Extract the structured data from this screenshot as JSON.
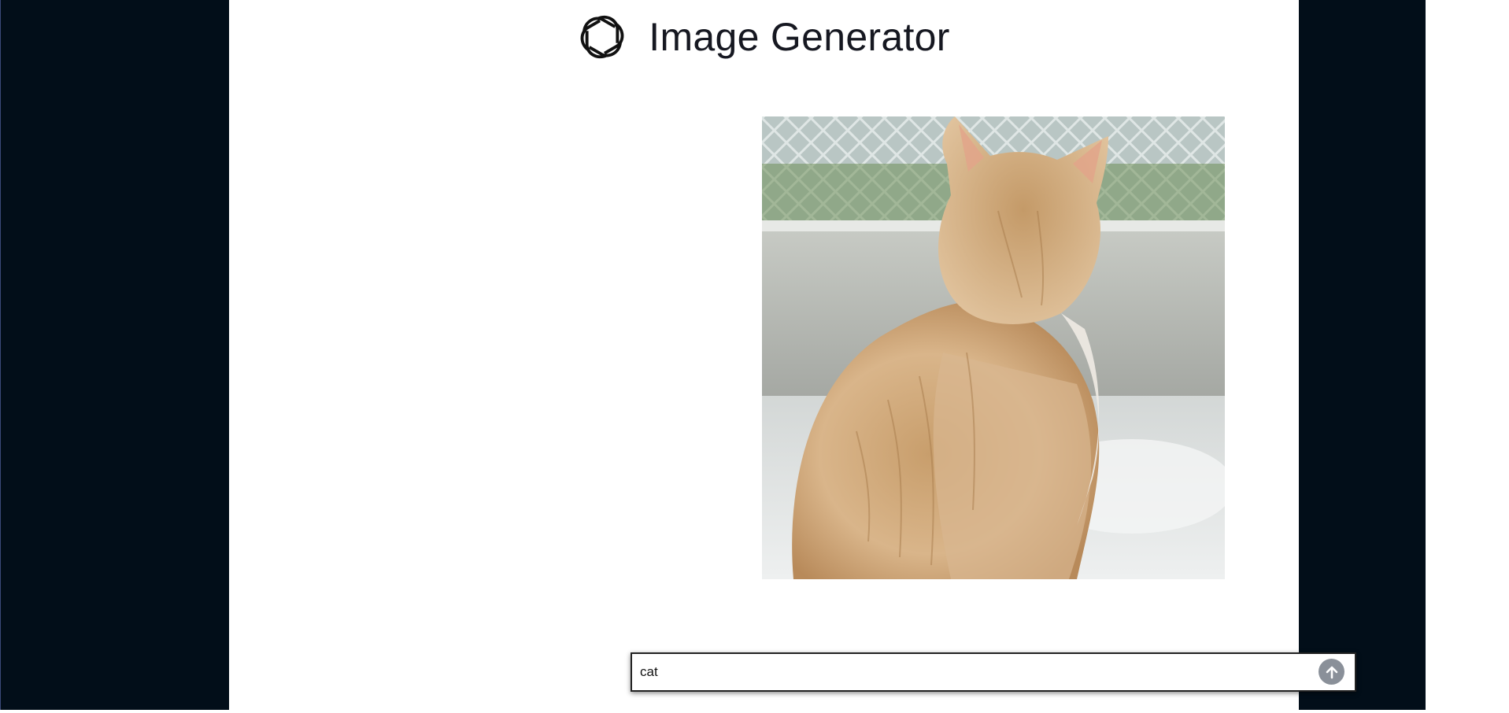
{
  "header": {
    "title": "Image Generator",
    "logo_icon": "openai-logo-icon"
  },
  "image": {
    "subject": "cat"
  },
  "prompt": {
    "value": "cat",
    "send_icon": "arrow-up-icon"
  },
  "colors": {
    "sidebar": "#020e19",
    "background": "#ffffff",
    "title": "#161821",
    "send_button": "#8a9099"
  }
}
